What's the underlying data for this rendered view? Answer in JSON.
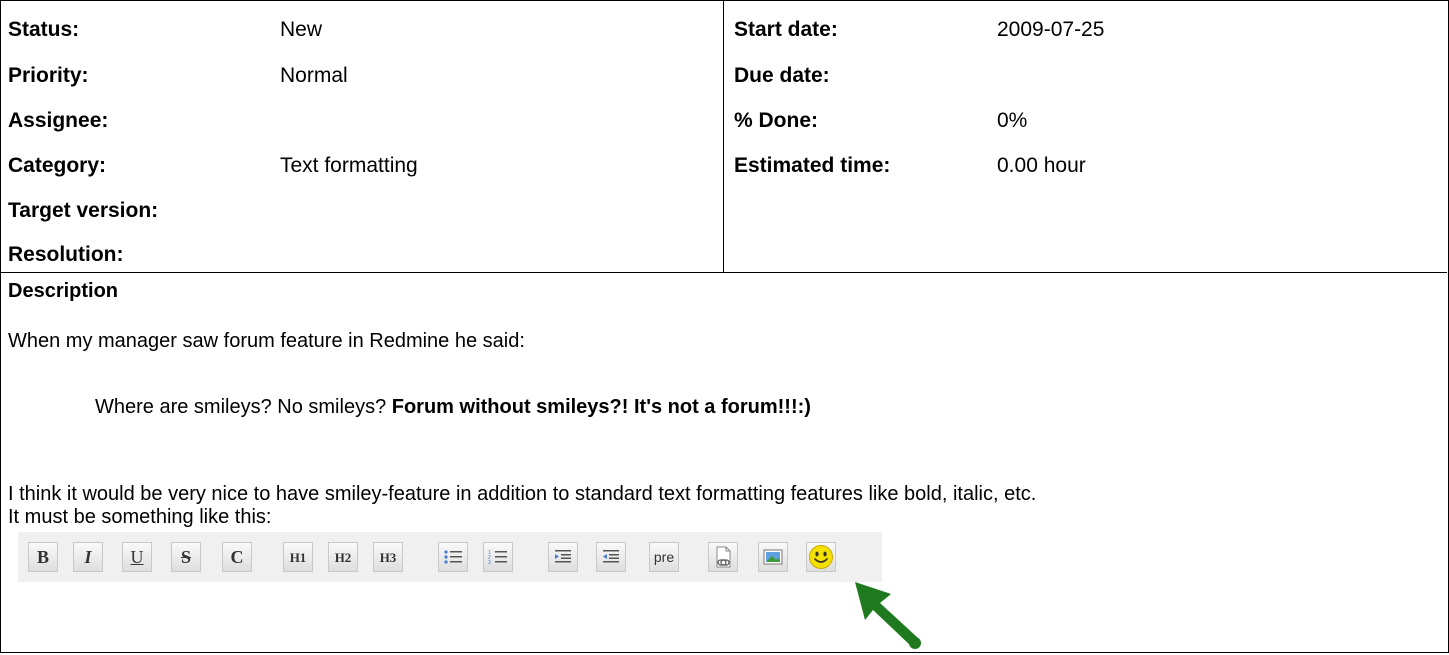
{
  "attributes": {
    "left": [
      {
        "label": "Status:",
        "value": "New"
      },
      {
        "label": "Priority:",
        "value": "Normal"
      },
      {
        "label": "Assignee:",
        "value": ""
      },
      {
        "label": "Category:",
        "value": "Text formatting"
      },
      {
        "label": "Target version:",
        "value": ""
      },
      {
        "label": "Resolution:",
        "value": ""
      }
    ],
    "right": [
      {
        "label": "Start date:",
        "value": "2009-07-25"
      },
      {
        "label": "Due date:",
        "value": ""
      },
      {
        "label": "% Done:",
        "value": "0%"
      },
      {
        "label": "Estimated time:",
        "value": "0.00 hour"
      }
    ]
  },
  "description": {
    "title": "Description",
    "intro": "When my manager saw forum feature in Redmine he said:",
    "quote_plain": "Where are smileys? No smileys? ",
    "quote_bold": "Forum without smileys?! It's not a forum!!!:)",
    "line1": "I think it would be very nice to have smiley-feature in addition to standard text formatting features like bold, italic, etc.",
    "line2": "It must be something like this:"
  },
  "toolbar": {
    "buttons": [
      {
        "name": "bold-button",
        "label": "B",
        "style": "bold"
      },
      {
        "name": "italic-button",
        "label": "I",
        "style": "italic"
      },
      {
        "name": "underline-button",
        "label": "U",
        "style": "underline"
      },
      {
        "name": "strikethrough-button",
        "label": "S",
        "style": "strike"
      },
      {
        "name": "code-button",
        "label": "C",
        "style": "bold"
      },
      {
        "name": "heading1-button",
        "label": "H1",
        "style": "hdr"
      },
      {
        "name": "heading2-button",
        "label": "H2",
        "style": "hdr"
      },
      {
        "name": "heading3-button",
        "label": "H3",
        "style": "hdr"
      },
      {
        "name": "unordered-list-button",
        "label": "",
        "icon": "unordered-list-icon"
      },
      {
        "name": "ordered-list-button",
        "label": "",
        "icon": "ordered-list-icon"
      },
      {
        "name": "quote-button",
        "label": "",
        "icon": "quote-icon"
      },
      {
        "name": "unquote-button",
        "label": "",
        "icon": "unquote-icon"
      },
      {
        "name": "preformatted-button",
        "label": "pre",
        "style": "pre"
      },
      {
        "name": "wiki-link-button",
        "label": "",
        "icon": "link-icon"
      },
      {
        "name": "image-button",
        "label": "",
        "icon": "image-icon"
      },
      {
        "name": "smiley-button",
        "label": "",
        "icon": "smiley-icon"
      }
    ]
  },
  "colors": {
    "arrow": "#1f7a1f",
    "smiley": "#f5e100"
  }
}
